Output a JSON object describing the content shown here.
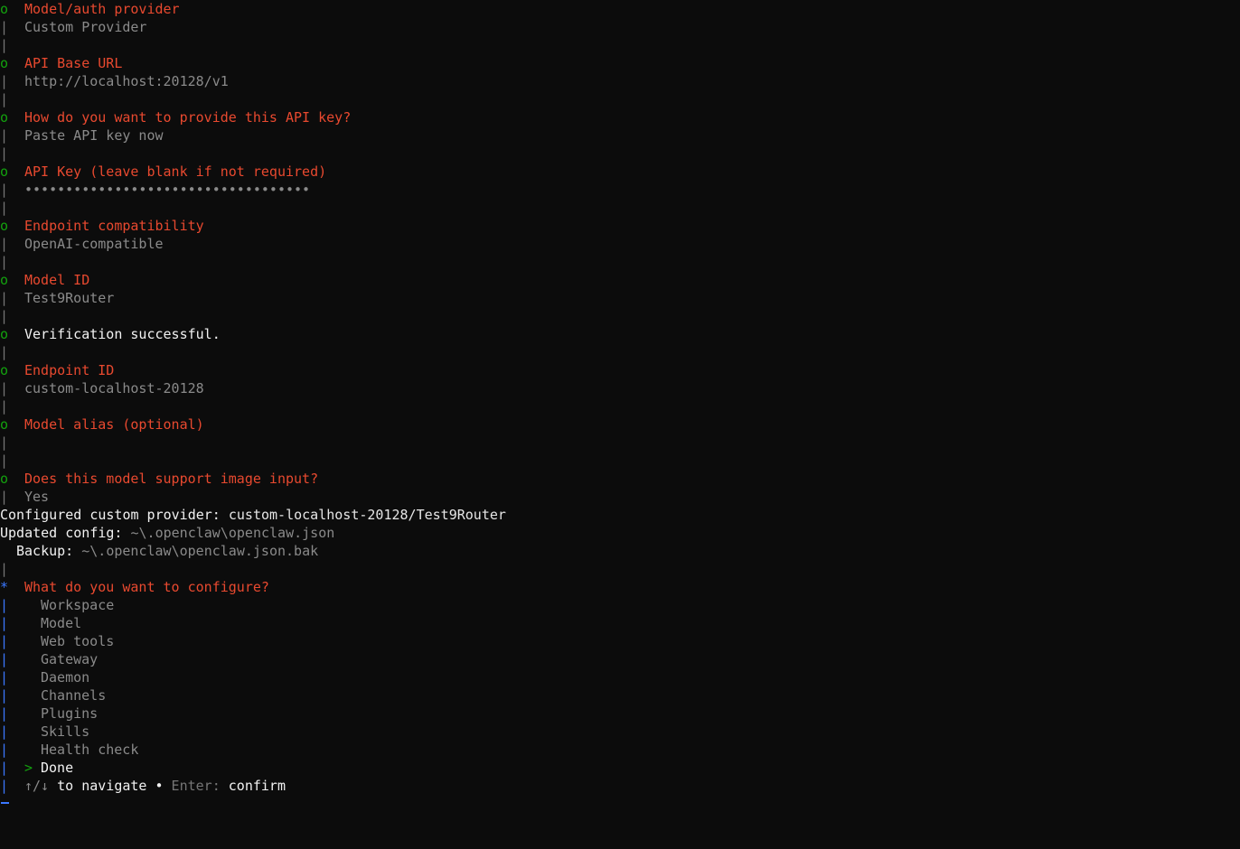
{
  "symbols": {
    "done_marker": "o",
    "active_marker": "*",
    "bar": "|",
    "pointer": ">"
  },
  "steps": [
    {
      "label": "Model/auth provider",
      "answer": "Custom Provider"
    },
    {
      "label": "API Base URL",
      "answer": "http://localhost:20128/v1"
    },
    {
      "label": "How do you want to provide this API key?",
      "answer": "Paste API key now"
    },
    {
      "label": "API Key (leave blank if not required)",
      "answer": "•••••••••••••••••••••••••••••••••••"
    },
    {
      "label": "Endpoint compatibility",
      "answer": "OpenAI-compatible"
    },
    {
      "label": "Model ID",
      "answer": "Test9Router"
    }
  ],
  "verification": "Verification successful.",
  "endpoint": {
    "label": "Endpoint ID",
    "answer": "custom-localhost-20128"
  },
  "alias": {
    "label": "Model alias (optional)",
    "answer": ""
  },
  "image_input": {
    "label": "Does this model support image input?",
    "answer": "Yes"
  },
  "summary": {
    "configured_prefix": "Configured custom provider: ",
    "configured_value": "custom-localhost-20128/Test9Router",
    "updated_prefix": "Updated config: ",
    "updated_value": "~\\.openclaw\\openclaw.json",
    "backup_prefix": "Backup: ",
    "backup_value": "~\\.openclaw\\openclaw.json.bak"
  },
  "menu": {
    "question": "What do you want to configure?",
    "options": [
      "Workspace",
      "Model",
      "Web tools",
      "Gateway",
      "Daemon",
      "Channels",
      "Plugins",
      "Skills",
      "Health check"
    ],
    "selected": "Done",
    "hint_arrows": "↑/↓",
    "hint_navigate": " to navigate ",
    "hint_dot": "•",
    "hint_enter": " Enter: ",
    "hint_confirm": "confirm"
  },
  "colors": {
    "background": "#0c0c0c",
    "prompt_label": "#e8492f",
    "done_marker": "#13a10e",
    "answer": "#8a8a8a",
    "active_bar": "#3b78ff"
  }
}
